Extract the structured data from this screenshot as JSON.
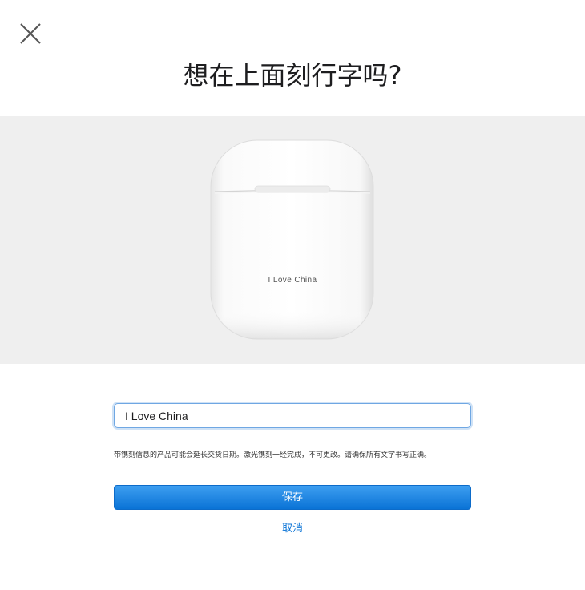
{
  "dialog": {
    "title": "想在上面刻行字吗?",
    "close_icon": "close-icon"
  },
  "preview": {
    "product_image": "airpods-case",
    "engraving_text": "I Love China"
  },
  "engraving_input": {
    "value": "I Love China",
    "placeholder": ""
  },
  "notice": "带镌刻信息的产品可能会延长交货日期。激光镌刻一经完成，不可更改。请确保所有文字书写正确。",
  "actions": {
    "save_label": "保存",
    "cancel_label": "取消"
  },
  "colors": {
    "accent": "#0a73d6",
    "preview_background": "#efefef"
  }
}
